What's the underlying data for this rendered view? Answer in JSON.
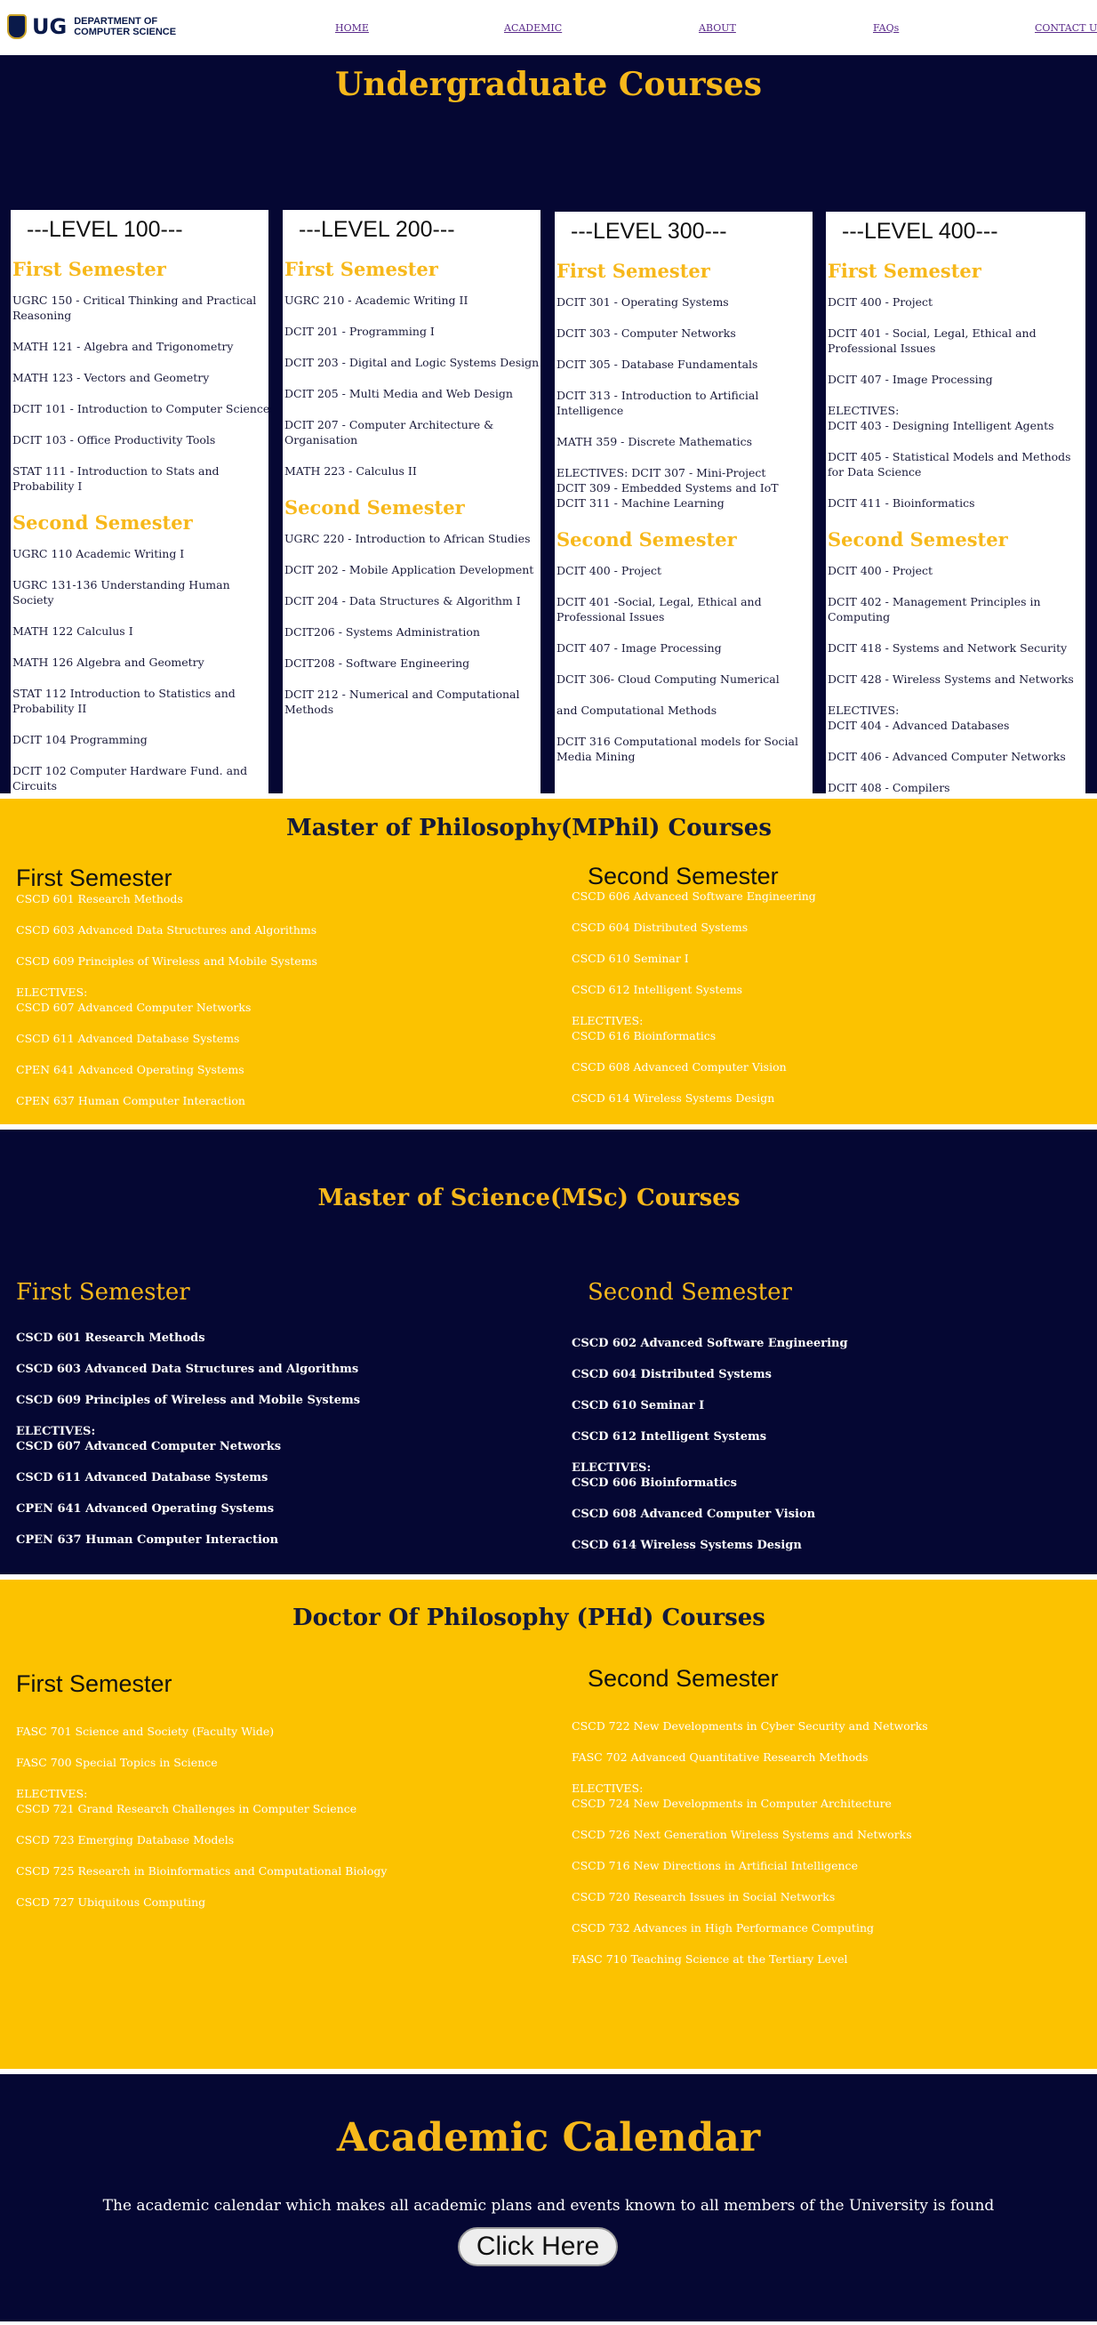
{
  "header": {
    "logo_text": "UG",
    "dept_line1": "DEPARTMENT OF",
    "dept_line2": "COMPUTER SCIENCE",
    "nav": [
      "HOME",
      "ACADEMIC",
      "ABOUT",
      "FAQs",
      "CONTACT US"
    ]
  },
  "undergrad": {
    "title": "Undergraduate Courses",
    "levels": [
      {
        "level": "---LEVEL 100---",
        "first_label": "First Semester",
        "first": [
          "UGRC 150 - Critical Thinking and Practical Reasoning",
          "MATH 121 - Algebra and Trigonometry",
          "MATH 123 - Vectors and Geometry",
          "DCIT 101 - Introduction to Computer Science",
          "DCIT 103 - Office Productivity Tools",
          "STAT 111 - Introduction to Stats and Probability I"
        ],
        "second_label": "Second Semester",
        "second": [
          "UGRC 110 Academic Writing I",
          "UGRC 131-136 Understanding Human Society",
          "MATH 122 Calculus I",
          "MATH 126 Algebra and Geometry",
          "STAT 112 Introduction to Statistics and Probability II",
          "DCIT 104 Programming",
          "DCIT 102 Computer Hardware Fund. and Circuits"
        ]
      },
      {
        "level": "---LEVEL 200---",
        "first_label": "First Semester",
        "first": [
          "UGRC 210 - Academic Writing II",
          "DCIT 201 - Programming I",
          "DCIT 203 - Digital and Logic Systems Design",
          "DCIT 205 - Multi Media and Web Design",
          "DCIT 207 - Computer Architecture & Organisation",
          "MATH 223 - Calculus II"
        ],
        "second_label": "Second Semester",
        "second": [
          "UGRC 220 - Introduction to African Studies",
          "DCIT 202 - Mobile Application Development",
          "DCIT 204 - Data Structures & Algorithm I",
          "DCIT206 - Systems Administration",
          "DCIT208 - Software Engineering",
          "DCIT 212 - Numerical and Computational Methods"
        ]
      },
      {
        "level": "---LEVEL 300---",
        "first_label": "First Semester",
        "first": [
          "DCIT 301 - Operating Systems",
          "DCIT 303 - Computer Networks",
          "DCIT 305 - Database Fundamentals",
          "DCIT 313 - Introduction to Artificial Intelligence",
          "MATH 359 - Discrete Mathematics",
          "ELECTIVES: DCIT 307 - Mini-Project\nDCIT 309 - Embedded Systems and IoT\nDCIT 311 - Machine Learning"
        ],
        "second_label": "Second Semester",
        "second": [
          "DCIT 400 - Project",
          "DCIT 401 -Social, Legal, Ethical and Professional Issues",
          "DCIT 407 - Image Processing",
          "DCIT 306- Cloud Computing Numerical",
          "and Computational Methods",
          "DCIT 316 Computational models for Social Media Mining"
        ]
      },
      {
        "level": "---LEVEL 400---",
        "first_label": "First Semester",
        "first": [
          "DCIT 400 - Project",
          "DCIT 401 - Social, Legal, Ethical and Professional Issues",
          "DCIT 407 - Image Processing",
          "ELECTIVES:\nDCIT 403 - Designing Intelligent Agents",
          "DCIT 405 - Statistical Models and Methods for Data Science",
          "DCIT 411 - Bioinformatics"
        ],
        "second_label": "Second Semester",
        "second": [
          "DCIT 400 - Project",
          "DCIT 402 - Management Principles in Computing",
          "DCIT 418 - Systems and Network Security",
          "DCIT 428 - Wireless Systems and Networks",
          "ELECTIVES:\nDCIT 404 - Advanced Databases",
          "DCIT 406 - Advanced Computer Networks",
          "DCIT 408 - Compilers"
        ]
      }
    ]
  },
  "mphil": {
    "title": "Master of Philosophy(MPhil) Courses",
    "first_label": "First Semester",
    "first": [
      "CSCD 601 Research Methods",
      "CSCD 603 Advanced Data Structures and Algorithms",
      "CSCD 609 Principles of Wireless and Mobile Systems",
      "ELECTIVES:\nCSCD 607 Advanced Computer Networks",
      "CSCD 611 Advanced Database Systems",
      "CPEN 641 Advanced Operating Systems",
      "CPEN 637 Human Computer Interaction"
    ],
    "second_label": "Second Semester",
    "second": [
      "CSCD 606 Advanced Software Engineering",
      "CSCD 604 Distributed Systems",
      "CSCD 610 Seminar I",
      "CSCD 612 Intelligent Systems",
      "ELECTIVES:\nCSCD 616 Bioinformatics",
      "CSCD 608 Advanced Computer Vision",
      "CSCD 614 Wireless Systems Design"
    ]
  },
  "msc": {
    "title": "Master of Science(MSc) Courses",
    "first_label": "First Semester",
    "first": [
      "CSCD 601 Research Methods",
      "CSCD 603 Advanced Data Structures and Algorithms",
      "CSCD 609 Principles of Wireless and Mobile Systems",
      "ELECTIVES:\nCSCD 607 Advanced Computer Networks",
      "CSCD 611 Advanced Database Systems",
      "CPEN 641 Advanced Operating Systems",
      "CPEN 637 Human Computer Interaction"
    ],
    "second_label": "Second Semester",
    "second": [
      "CSCD 602 Advanced Software Engineering",
      "CSCD 604 Distributed Systems",
      "CSCD 610 Seminar I",
      "CSCD 612 Intelligent Systems",
      "ELECTIVES:\nCSCD 606 Bioinformatics",
      "CSCD 608 Advanced Computer Vision",
      "CSCD 614 Wireless Systems Design"
    ]
  },
  "phd": {
    "title": "Doctor Of Philosophy (PHd) Courses",
    "first_label": "First Semester",
    "first": [
      "FASC 701 Science and Society (Faculty Wide)",
      "FASC 700 Special Topics in Science",
      "ELECTIVES:\nCSCD 721 Grand Research Challenges in Computer Science",
      "CSCD 723 Emerging Database Models",
      "CSCD 725 Research in Bioinformatics and Computational Biology",
      "CSCD 727 Ubiquitous Computing"
    ],
    "second_label": "Second Semester",
    "second": [
      "CSCD 722 New Developments in Cyber Security and Networks",
      "FASC 702 Advanced Quantitative Research Methods",
      "ELECTIVES:\nCSCD 724 New Developments in Computer Architecture",
      "CSCD 726 Next Generation Wireless Systems and Networks",
      "CSCD 716 New Directions in Artificial Intelligence",
      "CSCD 720 Research Issues in Social Networks",
      "CSCD 732 Advances in High Performance Computing",
      "FASC 710 Teaching Science at the Tertiary Level"
    ]
  },
  "calendar": {
    "title": "Academic Calendar",
    "text": "The academic calendar which makes all academic plans and events known to all members of the University is found",
    "button": "Click Here"
  }
}
